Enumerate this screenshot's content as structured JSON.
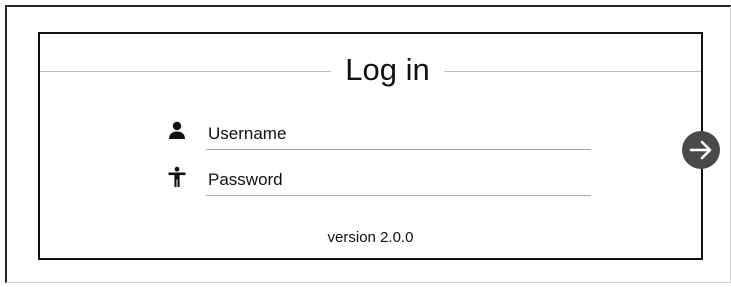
{
  "login": {
    "title": "Log in",
    "username": {
      "value": "",
      "placeholder": "Username",
      "icon": "person-icon"
    },
    "password": {
      "value": "",
      "placeholder": "Password",
      "icon": "accessibility-icon"
    },
    "version_text": "version 2.0.0",
    "submit_icon": "arrow-right-icon"
  },
  "colors": {
    "panel_border": "#111111",
    "divider": "#bdbdbd",
    "input_underline": "#a8a8a8",
    "submit_button": "#4a4a4a"
  }
}
